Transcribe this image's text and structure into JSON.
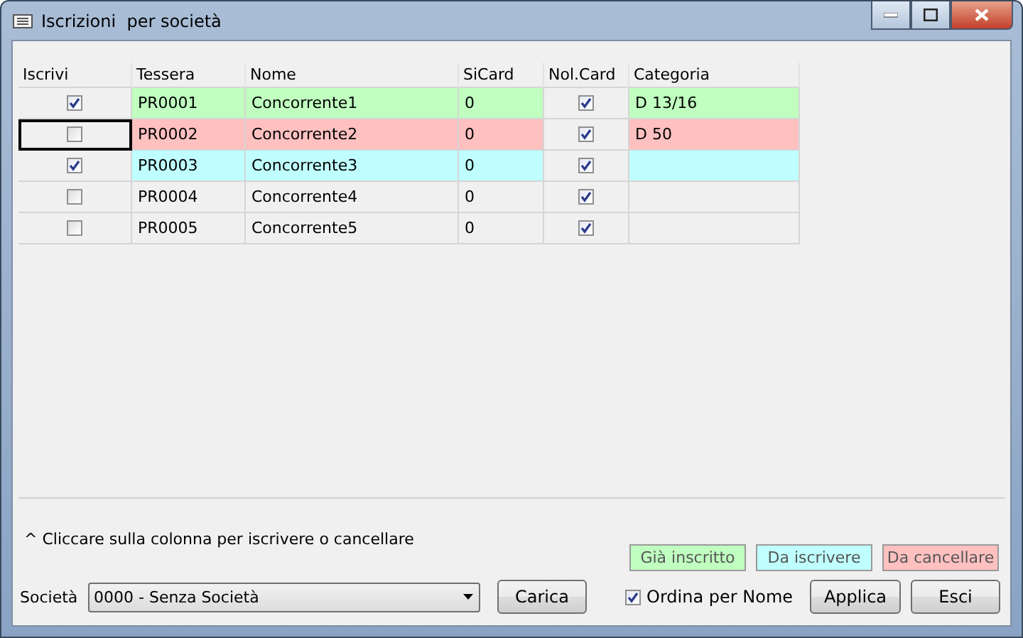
{
  "window": {
    "title": "Iscrizioni  per società"
  },
  "grid": {
    "columns": [
      "Iscrivi",
      "Tessera",
      "Nome",
      "SiCard",
      "Nol.Card",
      "Categoria"
    ],
    "rows": [
      {
        "checked": true,
        "focused": false,
        "tessera": "PR0001",
        "nome": "Concorrente1",
        "sicard": "0",
        "nolcard": true,
        "categoria": "D 13/16",
        "color": "#c0ffc0"
      },
      {
        "checked": false,
        "focused": true,
        "tessera": "PR0002",
        "nome": "Concorrente2",
        "sicard": "0",
        "nolcard": true,
        "categoria": "D 50",
        "color": "#ffc0c0"
      },
      {
        "checked": true,
        "focused": false,
        "tessera": "PR0003",
        "nome": "Concorrente3",
        "sicard": "0",
        "nolcard": true,
        "color": "#c0ffff"
      },
      {
        "checked": false,
        "focused": false,
        "tessera": "PR0004",
        "nome": "Concorrente4",
        "sicard": "0",
        "nolcard": true
      },
      {
        "checked": false,
        "focused": false,
        "tessera": "PR0005",
        "nome": "Concorrente5",
        "sicard": "0",
        "nolcard": true
      }
    ]
  },
  "hint": "^ Cliccare sulla colonna per iscrivere o cancellare",
  "legend": [
    {
      "label": "Già inscritto",
      "color": "#c0ffc0"
    },
    {
      "label": "Da iscrivere",
      "color": "#c0ffff"
    },
    {
      "label": "Da cancellare",
      "color": "#ffc0c0"
    }
  ],
  "societa": {
    "label": "Società",
    "value": "0000 - Senza Società"
  },
  "buttons": {
    "load": "Carica",
    "apply": "Applica",
    "exit": "Esci"
  },
  "sort": {
    "label": "Ordina per Nome",
    "checked": true
  }
}
